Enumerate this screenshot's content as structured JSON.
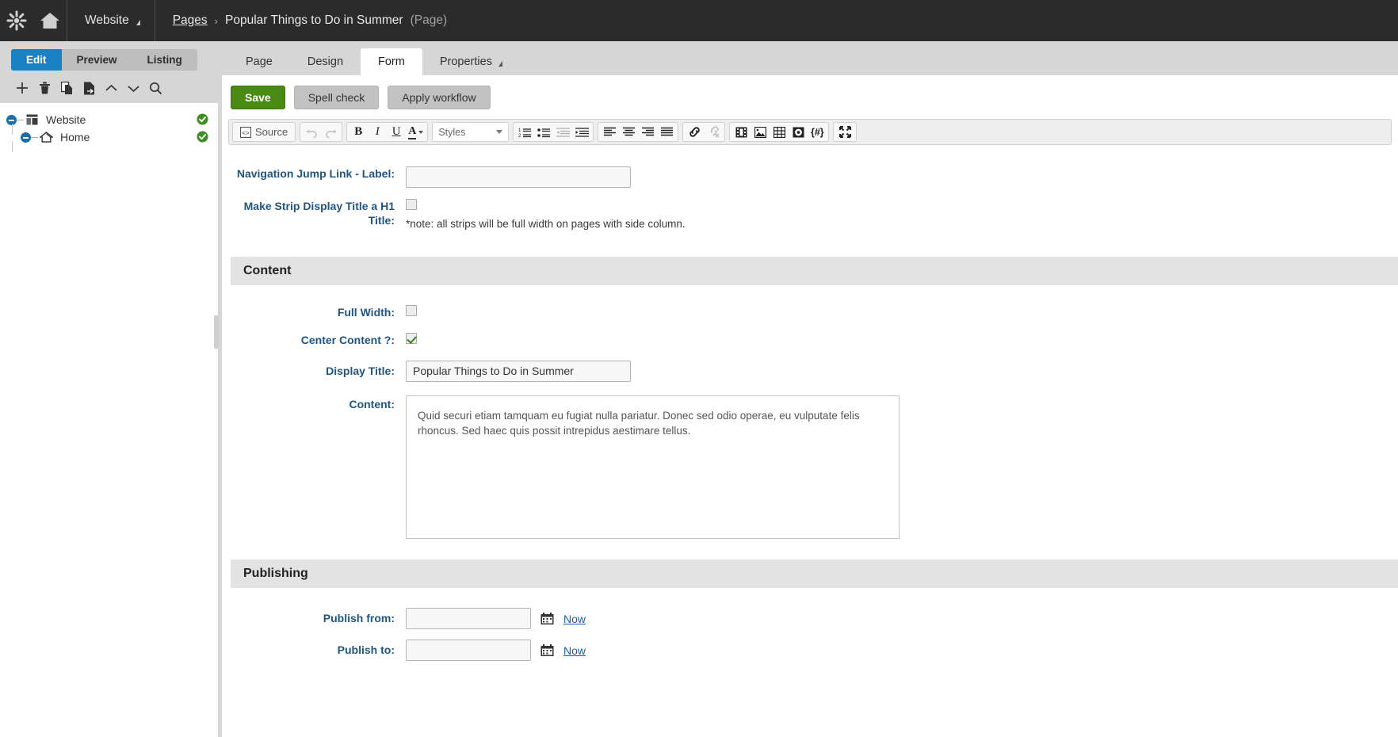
{
  "topbar": {
    "logo_icon": "asterisk-flower-logo-icon",
    "home_icon": "home-icon",
    "site_label": "Website",
    "breadcrumb": {
      "root": "Pages",
      "separator": "›",
      "current": "Popular Things to Do in Summer",
      "type": "(Page)"
    }
  },
  "left_panel": {
    "modes": [
      {
        "label": "Edit",
        "active": true
      },
      {
        "label": "Preview",
        "active": false
      },
      {
        "label": "Listing",
        "active": false
      }
    ],
    "tools": [
      {
        "name": "add-page-icon",
        "title": "New"
      },
      {
        "name": "delete-icon",
        "title": "Delete"
      },
      {
        "name": "copy-icon",
        "title": "Copy"
      },
      {
        "name": "move-page-icon",
        "title": "Move"
      },
      {
        "name": "move-up-icon",
        "title": "Up"
      },
      {
        "name": "move-down-icon",
        "title": "Down"
      },
      {
        "name": "search-icon",
        "title": "Search"
      }
    ],
    "tree": [
      {
        "label": "Website",
        "icon": "site-icon",
        "level": 1,
        "expanded": true,
        "status": "published"
      },
      {
        "label": "Home",
        "icon": "home-page-icon",
        "level": 2,
        "expanded": true,
        "status": "published"
      }
    ]
  },
  "main": {
    "tabs": [
      {
        "label": "Page",
        "active": false,
        "has_caret": false
      },
      {
        "label": "Design",
        "active": false,
        "has_caret": false
      },
      {
        "label": "Form",
        "active": true,
        "has_caret": false
      },
      {
        "label": "Properties",
        "active": false,
        "has_caret": true
      }
    ],
    "actions": [
      {
        "label": "Save",
        "style": "primary"
      },
      {
        "label": "Spell check",
        "style": "default"
      },
      {
        "label": "Apply workflow",
        "style": "default"
      }
    ],
    "toolbar": {
      "source_label": "Source",
      "styles_label": "Styles",
      "groups": [
        {
          "items": [
            {
              "name": "source-icon",
              "glyph": "▣",
              "label": "Source",
              "disabled": false
            }
          ]
        },
        {
          "items": [
            {
              "name": "undo-icon",
              "glyph": "↶",
              "disabled": true
            },
            {
              "name": "redo-icon",
              "glyph": "↷",
              "disabled": true
            }
          ]
        },
        {
          "items": [
            {
              "name": "bold-icon",
              "glyph": "B",
              "disabled": false
            },
            {
              "name": "italic-icon",
              "glyph": "I",
              "disabled": false
            },
            {
              "name": "underline-icon",
              "glyph": "U",
              "disabled": false
            },
            {
              "name": "text-color-icon",
              "glyph": "A",
              "disabled": false
            }
          ]
        },
        {
          "items": [
            {
              "name": "numbered-list-icon",
              "disabled": false
            },
            {
              "name": "bulleted-list-icon",
              "disabled": false
            },
            {
              "name": "outdent-icon",
              "disabled": true
            },
            {
              "name": "indent-icon",
              "disabled": false
            }
          ]
        },
        {
          "items": [
            {
              "name": "align-left-icon",
              "disabled": false
            },
            {
              "name": "align-center-icon",
              "disabled": false
            },
            {
              "name": "align-right-icon",
              "disabled": false
            },
            {
              "name": "align-justify-icon",
              "disabled": false
            }
          ]
        },
        {
          "items": [
            {
              "name": "insert-link-icon",
              "disabled": false
            },
            {
              "name": "unlink-icon",
              "disabled": true
            }
          ]
        },
        {
          "items": [
            {
              "name": "insert-media-icon",
              "disabled": false
            },
            {
              "name": "insert-image-icon",
              "disabled": false
            },
            {
              "name": "insert-table-icon",
              "disabled": false
            },
            {
              "name": "insert-widget-icon",
              "disabled": false
            },
            {
              "name": "insert-placeholder-icon",
              "glyph": "{#}",
              "disabled": false
            }
          ]
        },
        {
          "items": [
            {
              "name": "maximize-icon",
              "disabled": false
            }
          ]
        }
      ]
    }
  },
  "form": {
    "top_fields": [
      {
        "label": "Navigation Jump Link - Label:",
        "type": "text",
        "value": ""
      },
      {
        "label": "Make Strip Display Title a H1 Title:",
        "type": "checkbox",
        "checked": false
      }
    ],
    "strip_note": "*note: all strips will be full width on pages with side column.",
    "sections": [
      {
        "title": "Content",
        "fields": [
          {
            "label": "Full Width:",
            "type": "checkbox",
            "checked": false
          },
          {
            "label": "Center Content ?:",
            "type": "checkbox",
            "checked": true
          },
          {
            "label": "Display Title:",
            "type": "text",
            "value": "Popular Things to Do in Summer"
          },
          {
            "label": "Content:",
            "type": "richtext",
            "value": "Quid securi etiam tamquam eu fugiat nulla pariatur. Donec sed odio operae, eu vulputate felis rhoncus. Sed haec quis possit intrepidus aestimare tellus."
          }
        ]
      },
      {
        "title": "Publishing",
        "fields": [
          {
            "label": "Publish from:",
            "type": "date",
            "value": "",
            "calendar_icon": "calendar-icon",
            "now_label": "Now"
          },
          {
            "label": "Publish to:",
            "type": "date",
            "value": "",
            "calendar_icon": "calendar-icon",
            "now_label": "Now"
          }
        ]
      }
    ]
  },
  "colors": {
    "topbar_bg": "#2b2b2b",
    "accent_blue": "#1a82c3",
    "save_green": "#4a8a14",
    "label_blue": "#1f5582",
    "link_blue": "#1560a8",
    "panel_gray": "#d6d6d6",
    "section_gray": "#e3e3e3",
    "status_green": "#3f8e20"
  }
}
